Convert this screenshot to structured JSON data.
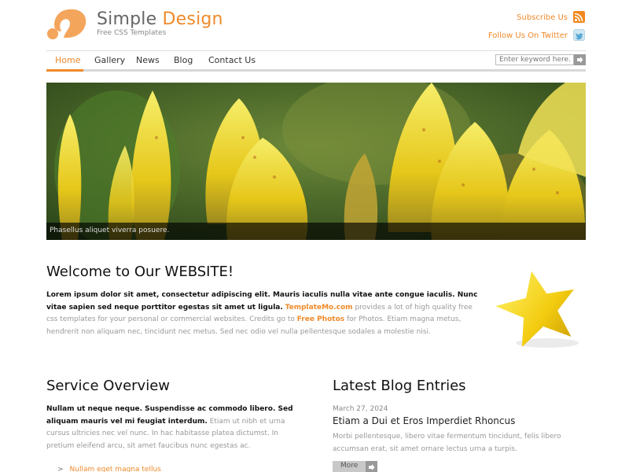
{
  "header": {
    "title_part1": "Simple",
    "title_part2": "Design",
    "subtitle": "Free CSS Templates",
    "subscribe_label": "Subscribe Us",
    "twitter_label": "Follow Us On Twitter"
  },
  "nav": {
    "items": [
      {
        "label": "Home",
        "active": true
      },
      {
        "label": "Gallery",
        "active": false
      },
      {
        "label": "News",
        "active": false
      },
      {
        "label": "Blog",
        "active": false
      },
      {
        "label": "Contact Us",
        "active": false
      }
    ],
    "search_placeholder": "Enter keyword here..."
  },
  "banner": {
    "caption": "Phasellus aliquet viverra posuere."
  },
  "welcome": {
    "heading": "Welcome to Our WEBSITE!",
    "bold_lead": "Lorem ipsum dolor sit amet, consectetur adipiscing elit. Mauris iaculis nulla vitae ante congue iaculis. Nunc vitae sapien sed neque porttitor egestas sit amet ut ligula.",
    "link1": "TemplateMo.com",
    "text1": "provides a lot of high quality free css templates for your personal or commercial websites. Credits go to",
    "link2": "Free Photos",
    "text2": "for Photos. Etiam magna metus, hendrerit non aliquam nec, tincidunt nec metus. Sed nec odio vel nulla pellentesque sodales a molestie nisi."
  },
  "service": {
    "heading": "Service Overview",
    "bold_lead": "Nullam ut neque neque. Suspendisse ac commodo libero. Sed aliquam mauris vel mi feugiat interdum.",
    "text": "Etiam ut nibh et urna cursus ultricies nec vel nunc. In hac habitasse platea dictumst. In pretium eleifend arcu, sit amet faucibus nunc egestas ac.",
    "list": [
      "Nullam eget magna tellus"
    ]
  },
  "blog": {
    "heading": "Latest Blog Entries",
    "date": "March 27, 2024",
    "entry_title": "Etiam a Dui et Eros Imperdiet Rhoncus",
    "excerpt": "Morbi pellentesque, libero vitae fermentum tincidunt, felis libero accumsan erat, sit amet ornare lectus urna a turpis.",
    "more_label": "More"
  },
  "colors": {
    "accent": "#ef8a2a",
    "nav_border": "#d8d8d8",
    "heading": "#111111"
  }
}
